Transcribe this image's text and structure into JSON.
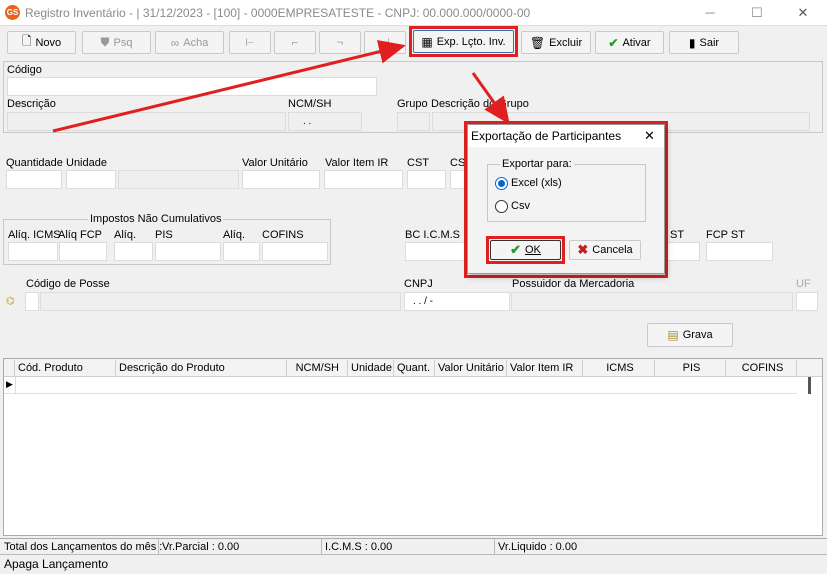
{
  "window": {
    "app_icon_text": "GS",
    "title": "Registro Inventário - |  31/12/2023 - [100] - 0000EMPRESATESTE - CNPJ: 00.000.000/0000-00"
  },
  "toolbar": {
    "novo": "Novo",
    "psq": "Psq",
    "acha": "Acha",
    "exp": "Exp. Lçto. Inv.",
    "excluir": "Excluir",
    "ativar": "Ativar",
    "sair": "Sair"
  },
  "form": {
    "codigo": "Código",
    "descricao": "Descrição",
    "ncmsh": "NCM/SH",
    "ncm_value": ". .",
    "grupo": "Grupo",
    "descricao_grupo": "Descrição do Grupo",
    "quantidade": "Quantidade",
    "unidade": "Unidade",
    "valor_unitario": "Valor Unitário",
    "valor_item_ir": "Valor Item IR",
    "cst": "CST",
    "cs": "CS",
    "impostos_group": "Impostos Não Cumulativos",
    "aliq_icms": "Alíq. ICMS",
    "aliq_fcp": "Alíq FCP",
    "aliq1": "Alíq.",
    "pis": "PIS",
    "aliq2": "Alíq.",
    "cofins": "COFINS",
    "bc_icms": "BC I.C.M.S",
    "st": "ST",
    "fcp_st": "FCP ST",
    "codigo_posse": "Código de Posse",
    "cnpj": "CNPJ",
    "cnpj_value": ".  .  /  -",
    "possuidor": "Possuidor da Mercadoria",
    "uf": "UF",
    "grava": "Grava"
  },
  "dialog": {
    "title": "Exportação de Participantes",
    "group": "Exportar para:",
    "option_excel": "Excel (xls)",
    "option_csv": "Csv",
    "selected": "Excel (xls)",
    "ok": "OK",
    "cancel": "Cancela"
  },
  "table": {
    "columns": [
      "Cód. Produto",
      "Descrição do Produto",
      "NCM/SH",
      "Unidade",
      "Quant.",
      "Valor Unitário",
      "Valor Item IR",
      "ICMS",
      "PIS",
      "COFINS"
    ]
  },
  "footer": {
    "total_label": "Total dos Lançamentos do mês :",
    "parcial": "Vr.Parcial : 0.00",
    "icms": "I.C.M.S : 0.00",
    "liquido": "Vr.Liquido : 0.00",
    "status": "Apaga Lançamento"
  },
  "colors": {
    "highlight": "#e02020",
    "accent": "#0a64c8"
  }
}
